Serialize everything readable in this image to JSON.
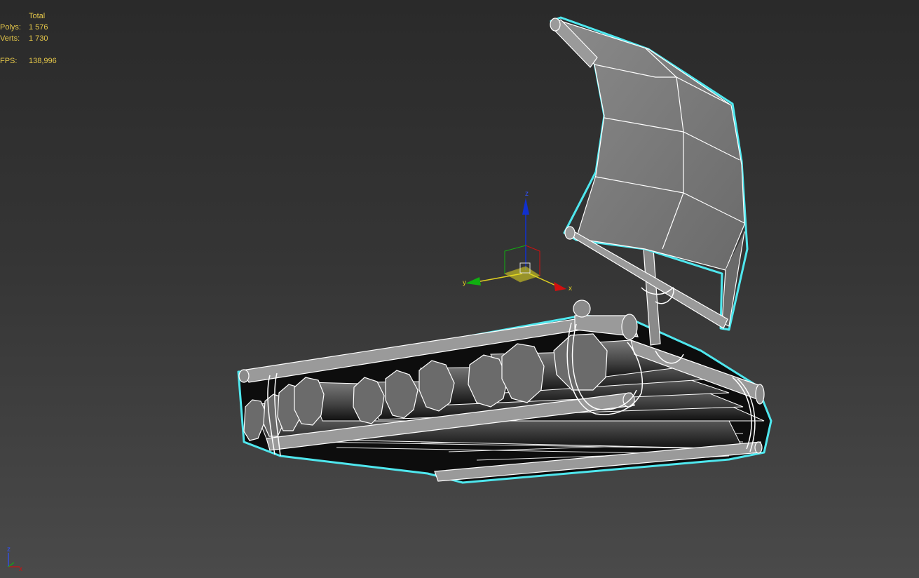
{
  "stats": {
    "header": "Total",
    "polys_label": "Polys:",
    "polys_value": "1 576",
    "verts_label": "Verts:",
    "verts_value": "1 730",
    "fps_label": "FPS:",
    "fps_value": "138,996"
  },
  "gizmo": {
    "x_label": "x",
    "y_label": "y",
    "z_label": "z"
  },
  "view_axes": {
    "x_label": "x",
    "z_label": "z"
  },
  "colors": {
    "stats_text": "#e6c84a",
    "selection_outline": "#4fe7ee",
    "axis_x": "#d01010",
    "axis_y": "#10b010",
    "axis_z": "#1030d0",
    "model_fill": "#6a6a6a",
    "wire": "#ffffff"
  }
}
